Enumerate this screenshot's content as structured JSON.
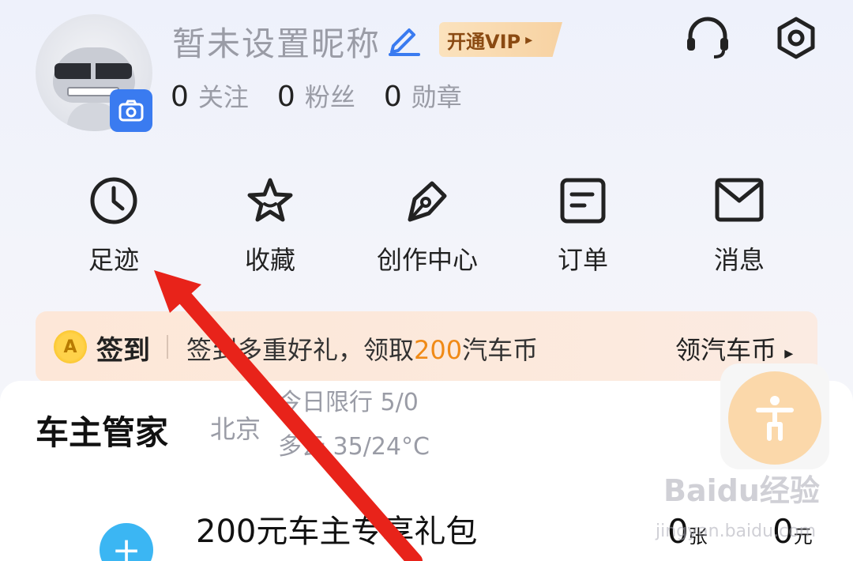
{
  "profile": {
    "nickname": "暂未设置昵称",
    "vip_label": "开通VIP",
    "vip_chevron": "▸",
    "stats": [
      {
        "value": "0",
        "label": "关注"
      },
      {
        "value": "0",
        "label": "粉丝"
      },
      {
        "value": "0",
        "label": "勋章"
      }
    ]
  },
  "quick_menu": [
    {
      "label": "足迹",
      "icon": "clock-icon"
    },
    {
      "label": "收藏",
      "icon": "star-icon"
    },
    {
      "label": "创作中心",
      "icon": "pen-icon"
    },
    {
      "label": "订单",
      "icon": "order-icon"
    },
    {
      "label": "消息",
      "icon": "mail-icon"
    }
  ],
  "checkin": {
    "coin_glyph": "A",
    "title": "签到",
    "text_before": "签到多重好礼，领取",
    "highlight": "200",
    "text_after": "汽车币",
    "link": "领汽车币",
    "link_chevron": "▸"
  },
  "owner": {
    "title": "车主管家",
    "city": "北京",
    "limit": "今日限行 5/0",
    "weather": "多云 35/24°C",
    "plus": "+",
    "gift_title": "200元车主专享礼包",
    "count_tickets": "0",
    "tickets_unit": "张",
    "count_money": "0",
    "money_unit": "元"
  },
  "watermark": {
    "main": "Baidu经验",
    "sub": "jingyan.baidu.com"
  },
  "colors": {
    "accent_blue": "#3a7bf0",
    "highlight_orange": "#f08a16",
    "arrow_red": "#e8231a"
  }
}
